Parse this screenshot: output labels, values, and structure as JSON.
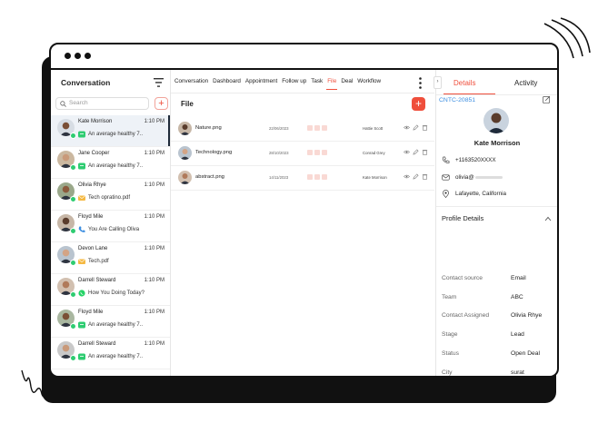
{
  "conversation_panel": {
    "title": "Conversation",
    "search_placeholder": "Search",
    "add_label": "+"
  },
  "contacts": [
    {
      "name": "Kate Morrison",
      "time": "1:10 PM",
      "message": "An average healthy 7..",
      "icon": "chat-icon",
      "active": true
    },
    {
      "name": "Jane Cooper",
      "time": "1:10 PM",
      "message": "An average healthy 7..",
      "icon": "chat-icon"
    },
    {
      "name": "Olivia Rhye",
      "time": "1:10 PM",
      "message": "Tech opratino.pdf",
      "icon": "email-icon"
    },
    {
      "name": "Floyd Mile",
      "time": "1:10 PM",
      "message": "You Are Calling Oliva",
      "icon": "phone-icon"
    },
    {
      "name": "Devon Lane",
      "time": "1:10 PM",
      "message": "Tech.pdf",
      "icon": "email-icon"
    },
    {
      "name": "Darrell Steward",
      "time": "1:10 PM",
      "message": "How You Doing Today?",
      "icon": "whatsapp-icon"
    },
    {
      "name": "Floyd Mile",
      "time": "1:10 PM",
      "message": "An average healthy 7..",
      "icon": "chat-icon"
    },
    {
      "name": "Darrell Steward",
      "time": "1:10 PM",
      "message": "An average healthy 7..",
      "icon": "chat-icon"
    }
  ],
  "tabs": [
    "Conversation",
    "Dashboard",
    "Appointment",
    "Follow up",
    "Task",
    "File",
    "Deal",
    "Workflow"
  ],
  "active_tab": "File",
  "file_section": {
    "title": "File",
    "add_label": "+",
    "files": [
      {
        "name": "Nature.png",
        "date": "22/06/2023",
        "owner": "Hattie Scott"
      },
      {
        "name": "Technology.png",
        "date": "28/10/2023",
        "owner": "Conrad Grey"
      },
      {
        "name": "abstract.png",
        "date": "14/11/2023",
        "owner": "Kate Morrison"
      }
    ]
  },
  "details_panel": {
    "tab_details": "Details",
    "tab_activity": "Activity",
    "contact_id": "CNTC-20851",
    "name": "Kate Morrison",
    "phone": "+1163520XXXX",
    "email": "olivia@",
    "location": "Lafayette, California",
    "profile_title": "Profile Details",
    "fields": [
      {
        "label": "Contact source",
        "value": "Email"
      },
      {
        "label": "Team",
        "value": "ABC"
      },
      {
        "label": "Contact Assigned",
        "value": "Olivia Rhye"
      },
      {
        "label": "Stage",
        "value": "Lead"
      },
      {
        "label": "Status",
        "value": "Open Deal"
      },
      {
        "label": "City",
        "value": "surat"
      }
    ]
  },
  "colors": {
    "accent": "#ef4f3c",
    "link": "#3b8de0",
    "online": "#2ecc71",
    "chat": "#2ecc71",
    "email": "#f5b942"
  }
}
